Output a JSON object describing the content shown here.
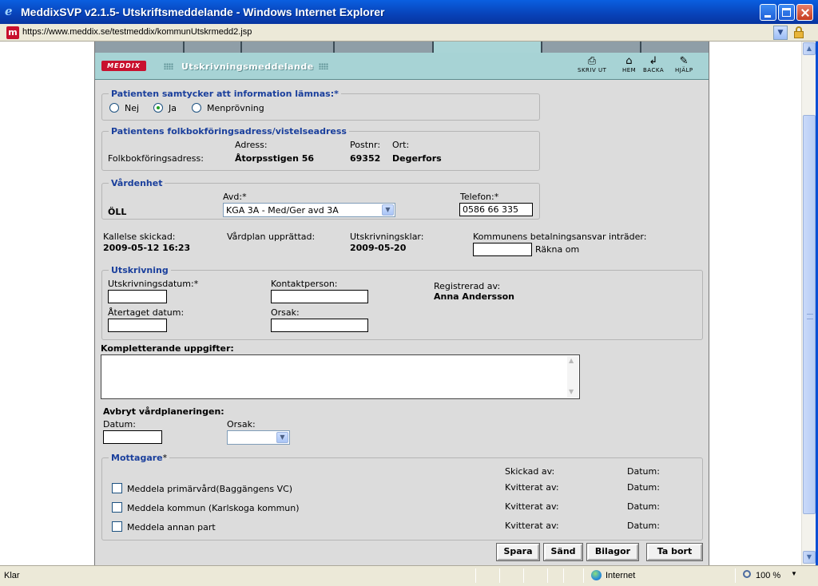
{
  "window": {
    "title": "MeddixSVP v2.1.5- Utskriftsmeddelande - Windows Internet Explorer",
    "url": "https://www.meddix.se/testmeddix/kommunUtskrmedd2.jsp"
  },
  "header": {
    "logo": "MEDDIX",
    "title": "Utskrivningsmeddelande",
    "tools": [
      {
        "icon": "printer-icon",
        "label": "SKRIV UT"
      },
      {
        "icon": "home-icon",
        "label": "HEM"
      },
      {
        "icon": "back-arrow-icon",
        "label": "BACKA"
      },
      {
        "icon": "help-icon",
        "label": "HJÄLP"
      }
    ]
  },
  "consent": {
    "legend": "Patienten samtycker att information lämnas:*",
    "options": [
      "Nej",
      "Ja",
      "Menprövning"
    ],
    "selected": "Ja"
  },
  "address": {
    "legend": "Patientens folkbokföringsadress/vistelseadress",
    "row_label": "Folkbokföringsadress:",
    "adress_label": "Adress:",
    "adress_value": "Åtorpsstigen 56",
    "postnr_label": "Postnr:",
    "postnr_value": "69352",
    "ort_label": "Ort:",
    "ort_value": "Degerfors"
  },
  "vardenhet": {
    "legend": "Vårdenhet",
    "unit": "ÖLL",
    "avd_label": "Avd:*",
    "avd_value": "KGA 3A - Med/Ger avd 3A",
    "telefon_label": "Telefon:*",
    "telefon_value": "0586 66 335"
  },
  "info": {
    "kallelse_label": "Kallelse skickad:",
    "kallelse_value": "2009-05-12 16:23",
    "vardplan_label": "Vårdplan upprättad:",
    "utskrivningsklar_label": "Utskrivningsklar:",
    "utskrivningsklar_value": "2009-05-20",
    "betalning_label": "Kommunens betalningsansvar inträder:",
    "rakna_om": "Räkna om"
  },
  "utskrivning": {
    "legend": "Utskrivning",
    "datum_label": "Utskrivningsdatum:*",
    "kontakt_label": "Kontaktperson:",
    "registrerad_label": "Registrerad av:",
    "registrerad_value": "Anna Andersson",
    "atertaget_label": "Återtaget datum:",
    "orsak_label": "Orsak:"
  },
  "komplett": {
    "label": "Kompletterande uppgifter:"
  },
  "avbryt": {
    "title": "Avbryt vårdplaneringen:",
    "datum_label": "Datum:",
    "orsak_label": "Orsak:"
  },
  "mottagare": {
    "legend": "Mottagare",
    "star": "*",
    "skickad_label": "Skickad av:",
    "datum_label": "Datum:",
    "kvitterat_label": "Kvitterat av:",
    "items": [
      "Meddela primärvård(Baggängens VC)",
      "Meddela kommun (Karlskoga kommun)",
      "Meddela annan part"
    ]
  },
  "buttons": {
    "spara": "Spara",
    "sand": "Sänd",
    "bilagor": "Bilagor",
    "ta_bort": "Ta bort"
  },
  "status": {
    "text": "Klar",
    "zone": "Internet",
    "zoom": "100 %"
  }
}
